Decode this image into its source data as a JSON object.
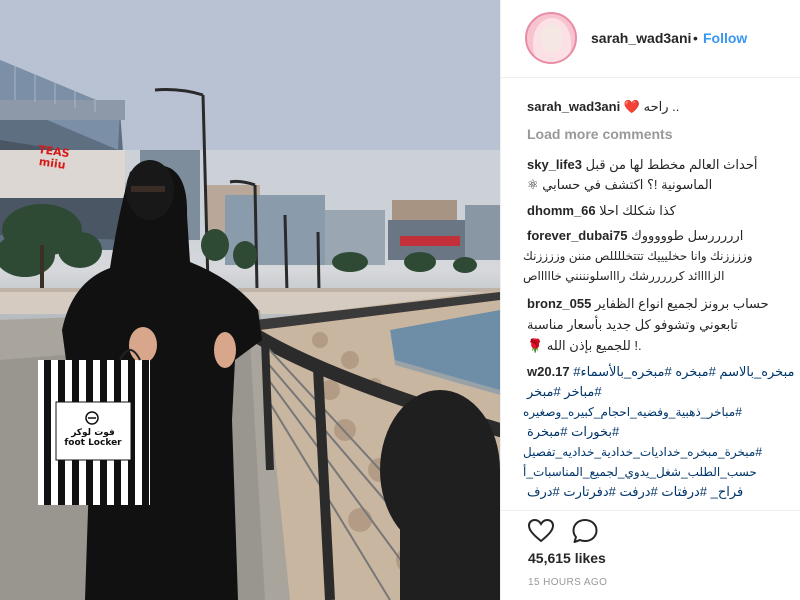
{
  "post": {
    "author": "sarah_wad3ani",
    "follow_label": "Follow",
    "separator": "•"
  },
  "photo": {
    "sign_text": "TEAS\nmiiu",
    "bag_text": "فوت لوكر\nfoot Locker",
    "colors": {
      "abaya": "#111111",
      "sky": "#b3bdd0",
      "bag_stripe": "#111111",
      "sign_red": "#d61a1a"
    }
  },
  "caption": {
    "user": "sarah_wad3ani",
    "text": "راحه ..",
    "emoji": "❤️"
  },
  "load_more": "Load more comments",
  "comments": [
    {
      "user": "sky_life3",
      "lines": [
        "أحداث العالم مخطط لها من قبل",
        "الماسونية !؟ اكتشف في حسابي"
      ],
      "emoji": "⚛"
    },
    {
      "user": "dhomm_66",
      "lines": [
        "كذا شكلك احلا"
      ]
    },
    {
      "user": "forever_dubai75",
      "lines": [
        "ارررررسل طوووووك",
        "وززززنك وانا حخليييك تتتخللللص مننن وززززنك",
        "الزاااائد كرررررشك راااسلونننني خاااااص"
      ]
    },
    {
      "user": "bronz_055",
      "lines": [
        "حساب برونز لجميع انواع الظفاير",
        "تابعوني وتشوفو كل جديد بأسعار مناسبة",
        "للجميع بإذن الله !."
      ]
    },
    {
      "user": "w20.17",
      "lines": [
        "#مبخره_بالاسم #مبخره #مبخره_بالأسماء",
        "#مباخر #مبخر",
        "#مباخر_ذهبية_وفضيه_احجام_كبيره_وصغيره",
        "#بخورات #مبخرة",
        "#مبخرة_مبخره_خداديات_خدادية_خداديه_تفصيل",
        "حسب_الطلب_شغل_يدوي_لجميع_المناسبات_أ",
        "فراح_ #درفتات #درفت #دفرتارت #درف"
      ]
    }
  ],
  "likes": "45,615 likes",
  "timestamp": "15 HOURS AGO",
  "icons": {
    "like": "heart-outline-icon",
    "comment": "comment-bubble-icon",
    "rose": "rose-icon"
  }
}
